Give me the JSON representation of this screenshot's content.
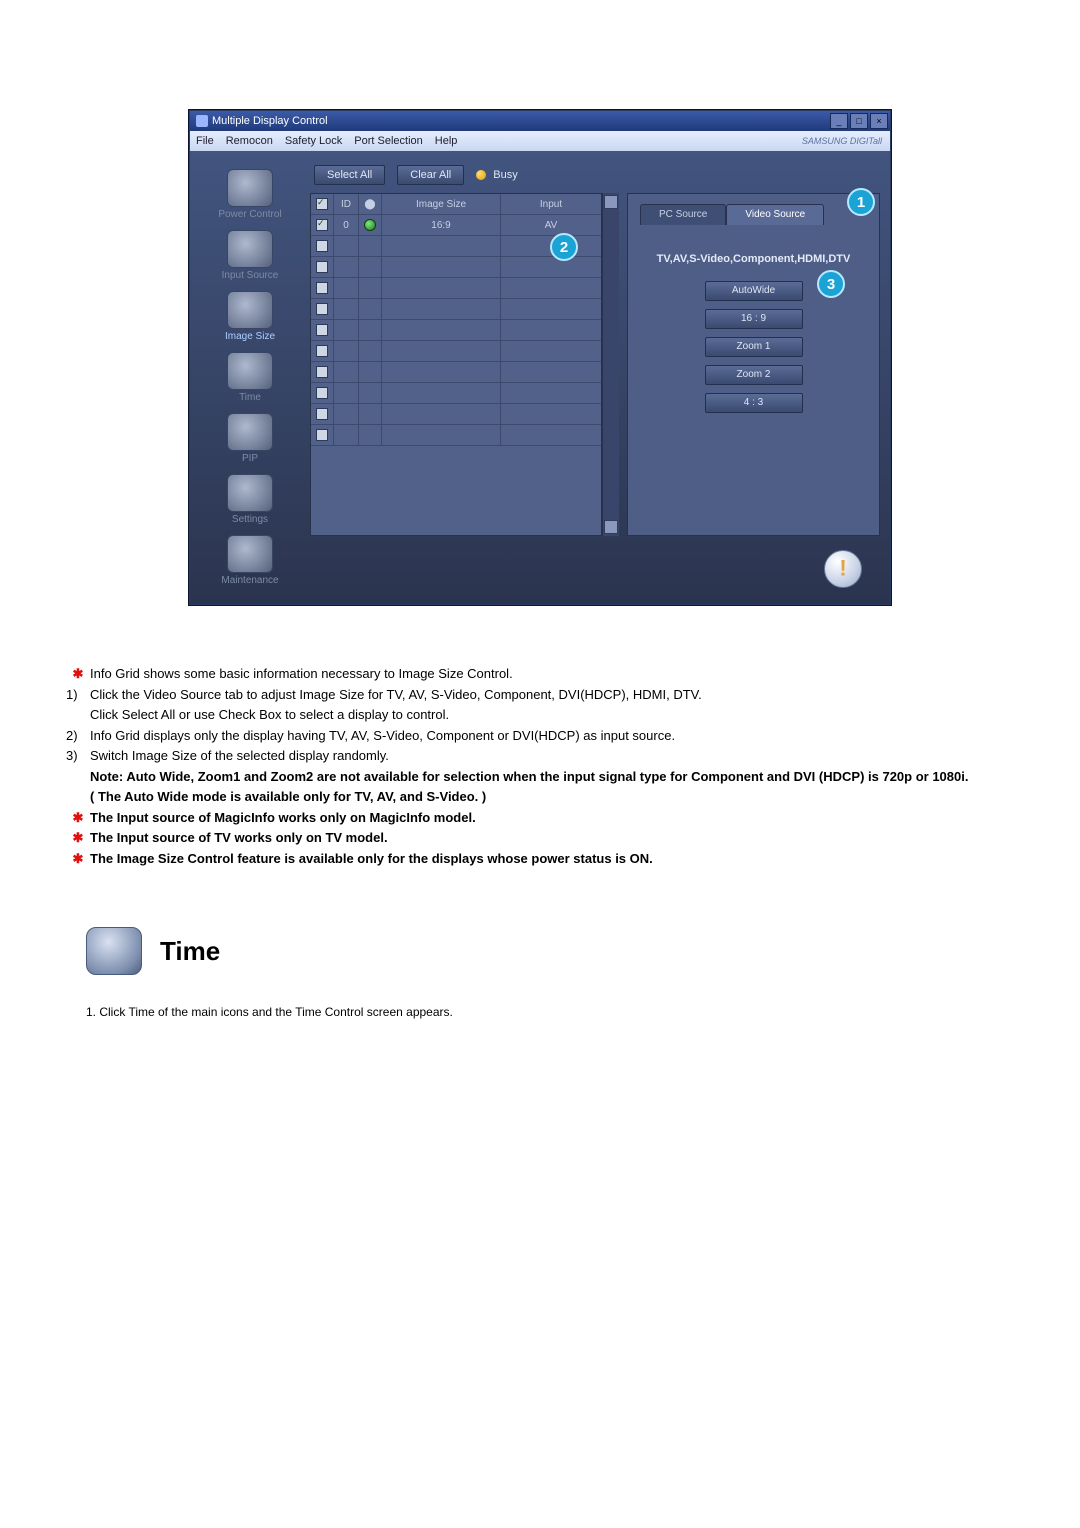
{
  "window": {
    "title": "Multiple Display Control",
    "brand": "SAMSUNG DIGITall",
    "menus": [
      "File",
      "Remocon",
      "Safety Lock",
      "Port Selection",
      "Help"
    ]
  },
  "sidebar": {
    "items": [
      {
        "label": "Power Control"
      },
      {
        "label": "Input Source"
      },
      {
        "label": "Image Size"
      },
      {
        "label": "Time"
      },
      {
        "label": "PIP"
      },
      {
        "label": "Settings"
      },
      {
        "label": "Maintenance"
      }
    ],
    "selected_index": 2
  },
  "toolbar": {
    "select_all": "Select All",
    "clear_all": "Clear All",
    "busy_label": "Busy"
  },
  "grid": {
    "headers": {
      "id": "ID",
      "image_size": "Image Size",
      "input": "Input"
    },
    "rows": [
      {
        "checked": true,
        "id": "0",
        "power": true,
        "image_size": "16:9",
        "input": "AV"
      },
      {
        "checked": false,
        "id": "",
        "power": false,
        "image_size": "",
        "input": ""
      },
      {
        "checked": false,
        "id": "",
        "power": false,
        "image_size": "",
        "input": ""
      },
      {
        "checked": false,
        "id": "",
        "power": false,
        "image_size": "",
        "input": ""
      },
      {
        "checked": false,
        "id": "",
        "power": false,
        "image_size": "",
        "input": ""
      },
      {
        "checked": false,
        "id": "",
        "power": false,
        "image_size": "",
        "input": ""
      },
      {
        "checked": false,
        "id": "",
        "power": false,
        "image_size": "",
        "input": ""
      },
      {
        "checked": false,
        "id": "",
        "power": false,
        "image_size": "",
        "input": ""
      },
      {
        "checked": false,
        "id": "",
        "power": false,
        "image_size": "",
        "input": ""
      },
      {
        "checked": false,
        "id": "",
        "power": false,
        "image_size": "",
        "input": ""
      },
      {
        "checked": false,
        "id": "",
        "power": false,
        "image_size": "",
        "input": ""
      }
    ]
  },
  "source_panel": {
    "tabs": {
      "pc_source": "PC Source",
      "video_source": "Video Source",
      "active": "video_source"
    },
    "title": "TV,AV,S-Video,Component,HDMI,DTV",
    "options": [
      "AutoWide",
      "16 : 9",
      "Zoom 1",
      "Zoom 2",
      "4 : 3"
    ]
  },
  "markers": {
    "m1": "1",
    "m2": "2",
    "m3": "3"
  },
  "notes": {
    "n_star1": "Info Grid shows some basic information necessary to Image Size Control.",
    "n1a": "Click the Video Source tab to adjust Image Size for TV, AV, S-Video, Component, DVI(HDCP), HDMI, DTV.",
    "n1b": "Click Select All or use Check Box to select a display to control.",
    "n2": "Info Grid displays only the display having TV, AV, S-Video, Component or DVI(HDCP) as input source.",
    "n3": "Switch Image Size of the selected display randomly.",
    "n3_note1": "Note: Auto Wide, Zoom1 and Zoom2 are not available for selection when the input signal type for Component and DVI (HDCP) is 720p or 1080i.",
    "n3_note2": "( The Auto Wide mode is available only for TV, AV, and S-Video. )",
    "n_star2": "The Input source of MagicInfo works only on MagicInfo model.",
    "n_star3": "The Input source of TV works only on TV model.",
    "n_star4": "The Image Size Control feature is available only for the displays whose power status is ON."
  },
  "section": {
    "heading": "Time",
    "body_1": "1.  Click Time of the main icons and the Time Control screen appears."
  }
}
